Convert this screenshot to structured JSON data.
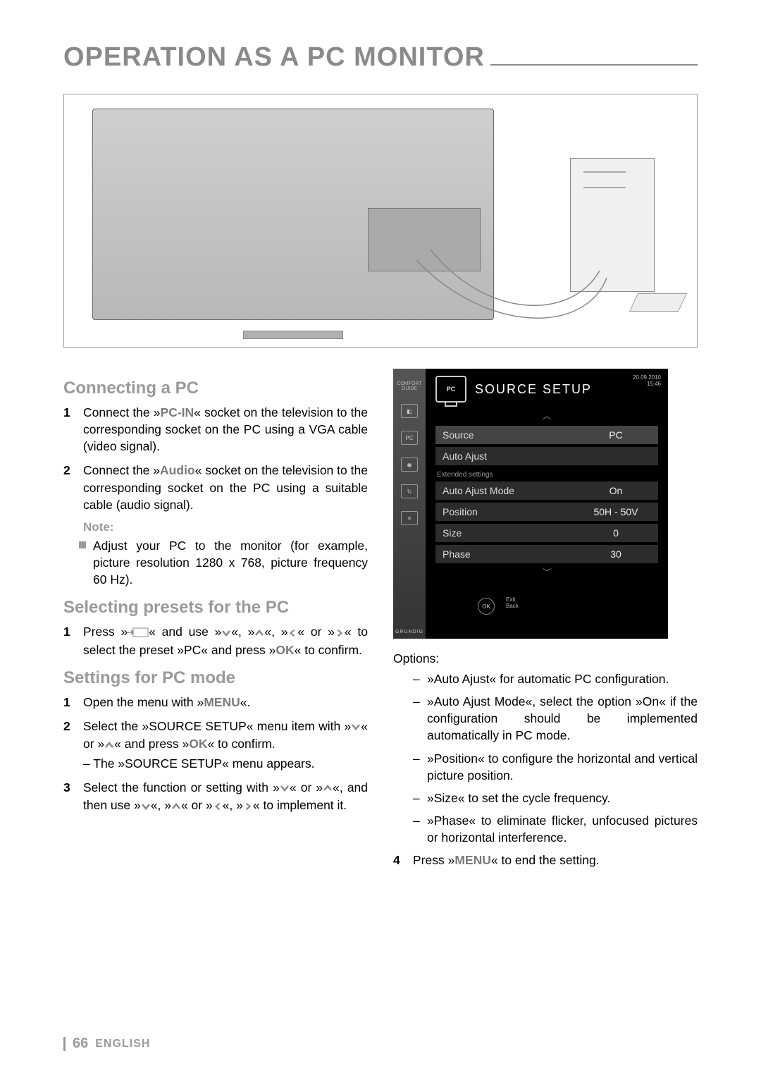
{
  "title": "OPERATION AS A PC MONITOR",
  "sections": {
    "connecting": {
      "heading": "Connecting a PC",
      "step1_pre": "Connect the »",
      "step1_bold": "PC-IN",
      "step1_post": "« socket on the television to the corresponding socket on the PC using a VGA cable (video signal).",
      "step2_pre": "Connect the »",
      "step2_bold": "Audio",
      "step2_post": "« socket on the televi­sion to the corresponding socket on the PC using a suitable cable (audio signal).",
      "note_label": "Note:",
      "note_body": "Adjust your PC to the monitor (for example, picture resolution 1280 x 768, picture fre­quency 60 Hz)."
    },
    "presets": {
      "heading": "Selecting presets for the PC",
      "step1_a": "Press »",
      "step1_b": "« and use »",
      "step1_c": "«, »",
      "step1_d": "«, »",
      "step1_e": "« or »",
      "step1_f": "« to select the preset »PC« and press »",
      "step1_ok": "OK",
      "step1_g": "« to confirm."
    },
    "settings": {
      "heading": "Settings for PC mode",
      "s1_a": "Open the menu with »",
      "s1_menu": "MENU",
      "s1_b": "«.",
      "s2_a": "Select the »SOURCE SETUP« menu item with »",
      "s2_b": "« or »",
      "s2_c": "« and press »",
      "s2_ok": "OK",
      "s2_d": "« to confirm.",
      "s2_sub": "– The »SOURCE SETUP« menu appears.",
      "s3_a": "Select the function or setting with »",
      "s3_b": "« or »",
      "s3_c": "«, and then use »",
      "s3_d": "«, »",
      "s3_e": "« or »",
      "s3_f": "«, »",
      "s3_g": "« to implement it.",
      "s4_a": "Press »",
      "s4_menu": "MENU",
      "s4_b": "« to end the setting."
    },
    "options": {
      "label": "Options:",
      "o1": "»Auto Ajust« for automatic PC configura­tion.",
      "o2": "»Auto Ajust Mode«, select the option »On« if the configuration should be imple­mented automatically in PC mode.",
      "o3": "»Position« to configure the horizontal and vertical picture position.",
      "o4": "»Size« to set the cycle frequency.",
      "o5": "»Phase« to eliminate flicker, unfocused pictures or horizontal interference."
    }
  },
  "osd": {
    "comfort": "COMFORT GUIDE",
    "pc_label": "PC",
    "title": "SOURCE SETUP",
    "date": "20.09.2010",
    "time": "15:46",
    "rows": {
      "source_label": "Source",
      "source_val": "PC",
      "autoajust_label": "Auto Ajust",
      "ext_label": "Extended settings",
      "mode_label": "Auto Ajust Mode",
      "mode_val": "On",
      "pos_label": "Position",
      "pos_val": "50H - 50V",
      "size_label": "Size",
      "size_val": "0",
      "phase_label": "Phase",
      "phase_val": "30"
    },
    "remote_ok": "OK",
    "remote_exit": "Exit",
    "remote_back": "Back",
    "brand": "GRUNDIG"
  },
  "footer": {
    "page": "66",
    "lang": "ENGLISH"
  }
}
